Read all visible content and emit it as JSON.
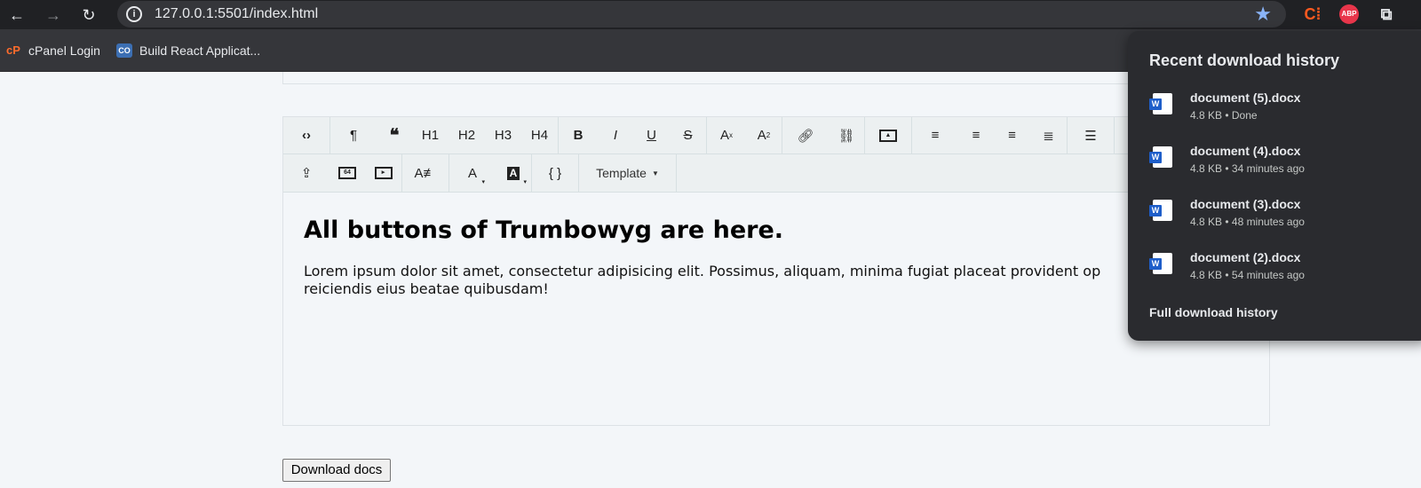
{
  "browser": {
    "url": "127.0.0.1:5501/index.html",
    "icons": {
      "back": "back-arrow-icon",
      "forward": "forward-arrow-icon",
      "reload": "reload-icon",
      "info": "info-icon",
      "star": "star-icon"
    },
    "extensions": {
      "c_label": "C⁞",
      "abp_label": "ABP"
    },
    "bookmarks": [
      {
        "label": "cPanel Login",
        "icon": "cP"
      },
      {
        "label": "Build React Applicat...",
        "icon": "CO"
      }
    ]
  },
  "editor": {
    "toolbar": {
      "row1": [
        "<>",
        "¶",
        "66",
        "H1",
        "H2",
        "H3",
        "H4",
        "B",
        "I",
        "U",
        "S",
        "Superscript",
        "Subscript",
        "Link",
        "Unlink",
        "Image",
        "Align left",
        "Align center",
        "Align right",
        "Justify",
        "Unordered list"
      ],
      "h1": "H1",
      "h2": "H2",
      "h3": "H3",
      "h4": "H4",
      "bold": "B",
      "italic": "I",
      "underline": "U",
      "strike": "S",
      "sup_base": "A",
      "sup_mark": "x",
      "sub_base": "A",
      "sub_mark": "2",
      "base64_label": "64",
      "font_color": "A",
      "bg_color": "A",
      "code": "{ }",
      "template": "Template"
    },
    "heading": "All buttons of Trumbowyg are here.",
    "paragraph": "Lorem ipsum dolor sit amet, consectetur adipisicing elit. Possimus, aliquam, minima fugiat placeat provident op",
    "paragraph_line2": "reiciendis eius beatae quibusdam!"
  },
  "download_button": "Download docs",
  "downloads": {
    "title": "Recent download history",
    "items": [
      {
        "name": "document (5).docx",
        "meta": "4.8 KB • Done"
      },
      {
        "name": "document (4).docx",
        "meta": "4.8 KB • 34 minutes ago"
      },
      {
        "name": "document (3).docx",
        "meta": "4.8 KB • 48 minutes ago"
      },
      {
        "name": "document (2).docx",
        "meta": "4.8 KB • 54 minutes ago"
      }
    ],
    "full_history": "Full download history",
    "file_icon_letter": "W"
  }
}
